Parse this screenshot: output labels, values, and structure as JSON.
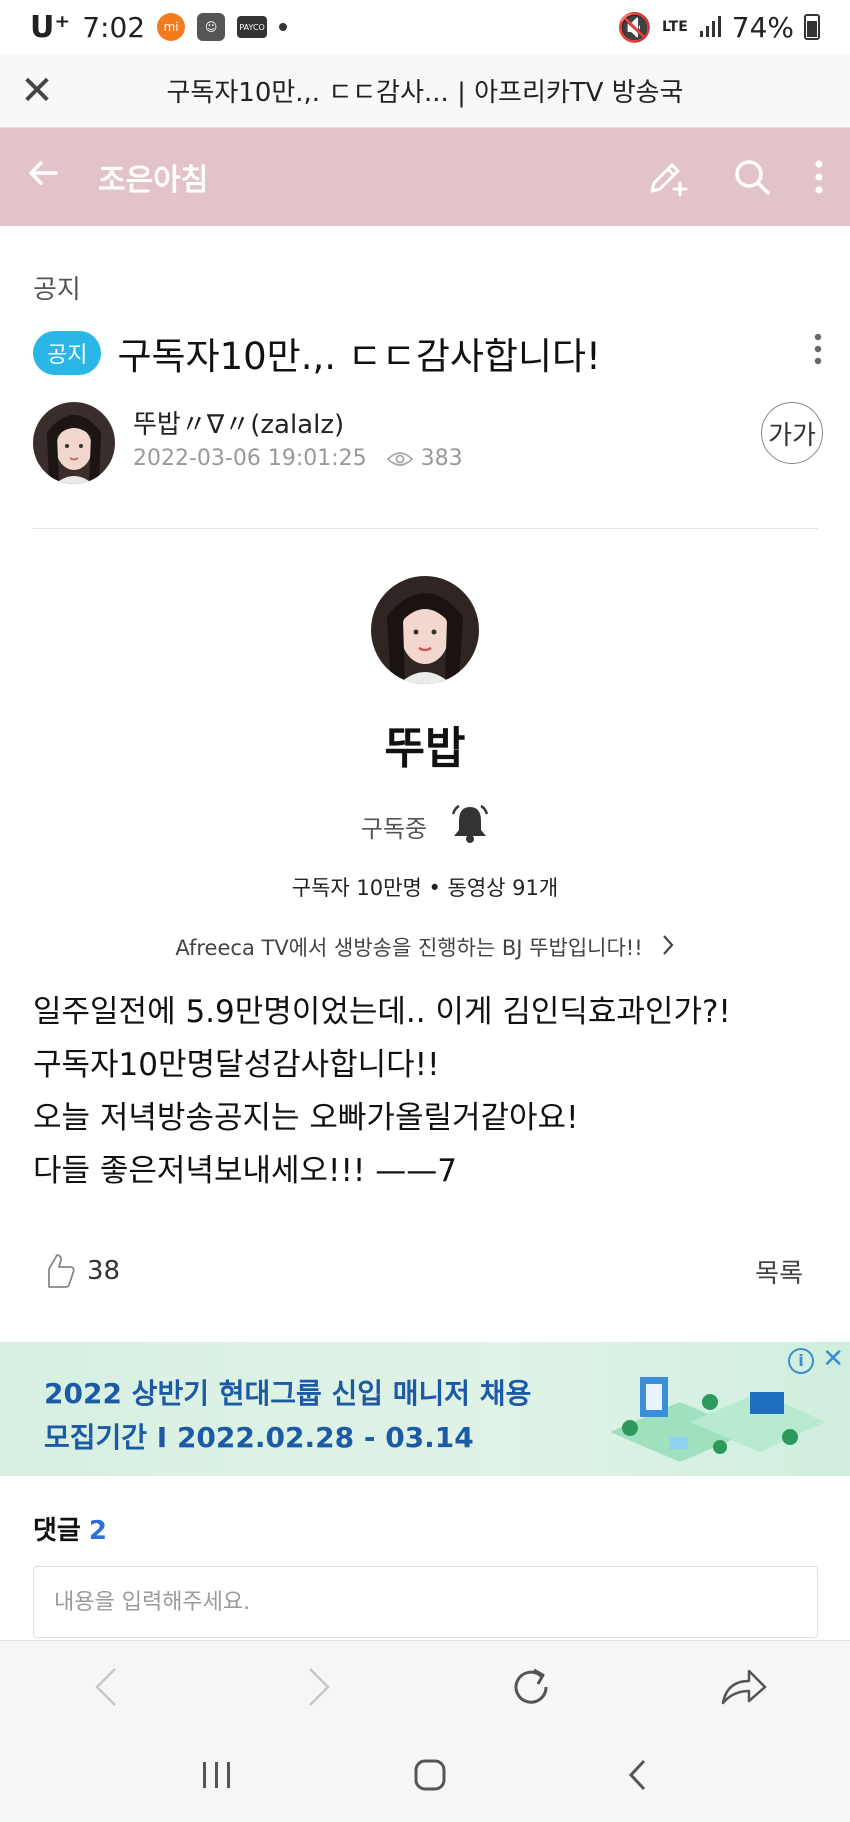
{
  "status_bar": {
    "carrier": "U⁺",
    "time": "7:02",
    "network": "LTE",
    "battery": "74%"
  },
  "browser_bar": {
    "page_title": "구독자10만.,. ㄷㄷ감사... | 아프리카TV 방송국"
  },
  "app_header": {
    "cafe_name": "조은아침"
  },
  "post": {
    "category": "공지",
    "badge": "공지",
    "title": "구독자10만.,. ㄷㄷ감사합니다!",
    "author": "뚜밥〃∇〃(zalalz)",
    "date": "2022-03-06 19:01:25",
    "views": "383",
    "font_size_button": "가가"
  },
  "profile_card": {
    "name": "뚜밥",
    "subscribe_state": "구독중",
    "stats": "구독자 10만명 • 동영상 91개",
    "description": "Afreeca TV에서 생방송을 진행하는 BJ 뚜밥입니다!!"
  },
  "body": {
    "lines": [
      "일주일전에 5.9만명이었는데..  이게 김인딕효과인가?!",
      "구독자10만명달성감사합니다!!",
      "오늘 저녁방송공지는 오빠가올릴거같아요!",
      "다들 좋은저녁보내세오!!! ——7"
    ]
  },
  "reactions": {
    "up_label": "UP",
    "likes": "38",
    "list_button": "목록"
  },
  "ad": {
    "line1": "2022 상반기 현대그룹 신입 매니저 채용",
    "line2": "모집기간 I 2022.02.28 - 03.14"
  },
  "comments": {
    "label": "댓글",
    "count": "2",
    "placeholder": "내용을 입력해주세요."
  },
  "colors": {
    "header_bg": "#e2c3c8",
    "badge": "#2ab6e6",
    "comment_count": "#2f6fd6",
    "ad_text": "#1c5aa6"
  }
}
